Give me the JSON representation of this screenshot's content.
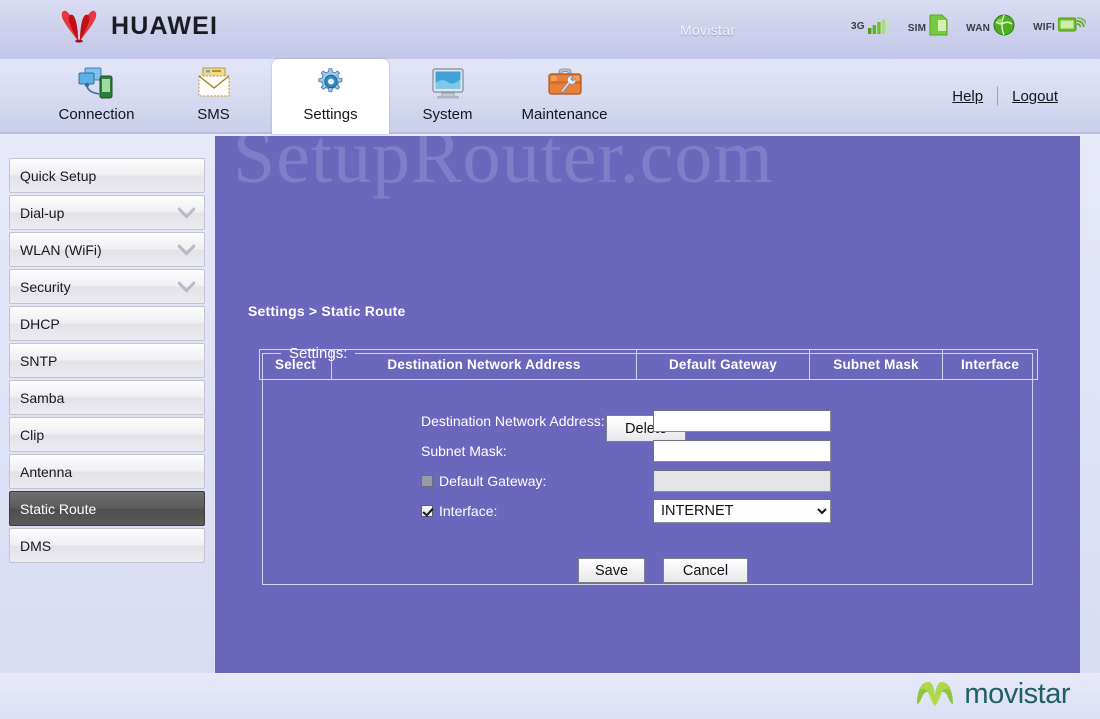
{
  "brand": {
    "vendor": "HUAWEI",
    "carrier": "Movistar",
    "logo_mark": "huawei-petal-logo",
    "logo_color": "#d8121c"
  },
  "status_icons": [
    {
      "label": "3G",
      "icon": "signal-bars-icon",
      "color": "#5eb318"
    },
    {
      "label": "SIM",
      "icon": "sim-card-icon",
      "color": "#7ac943"
    },
    {
      "label": "WAN",
      "icon": "globe-icon",
      "color": "#4caf22"
    },
    {
      "label": "WIFI",
      "icon": "wifi-signal-icon",
      "color": "#6fbf2a"
    }
  ],
  "nav": {
    "tabs": [
      {
        "label": "Connection",
        "icon": "connection-devices-icon",
        "active": false
      },
      {
        "label": "SMS",
        "icon": "envelope-icon",
        "active": false
      },
      {
        "label": "Settings",
        "icon": "gear-icon",
        "active": true
      },
      {
        "label": "System",
        "icon": "monitor-icon",
        "active": false
      },
      {
        "label": "Maintenance",
        "icon": "toolbox-wrench-icon",
        "active": false
      }
    ],
    "help_label": "Help",
    "logout_label": "Logout"
  },
  "sidebar": {
    "items": [
      {
        "label": "Quick Setup",
        "expandable": false,
        "selected": false
      },
      {
        "label": "Dial-up",
        "expandable": true,
        "selected": false
      },
      {
        "label": "WLAN (WiFi)",
        "expandable": true,
        "selected": false
      },
      {
        "label": "Security",
        "expandable": true,
        "selected": false
      },
      {
        "label": "DHCP",
        "expandable": false,
        "selected": false
      },
      {
        "label": "SNTP",
        "expandable": false,
        "selected": false
      },
      {
        "label": "Samba",
        "expandable": false,
        "selected": false
      },
      {
        "label": "Clip",
        "expandable": false,
        "selected": false
      },
      {
        "label": "Antenna",
        "expandable": false,
        "selected": false
      },
      {
        "label": "Static Route",
        "expandable": false,
        "selected": true
      },
      {
        "label": "DMS",
        "expandable": false,
        "selected": false
      }
    ]
  },
  "main": {
    "watermark": "SetupRouter.com",
    "breadcrumb": "Settings > Static Route",
    "table": {
      "headers": [
        "Select",
        "Destination Network Address",
        "Default Gateway",
        "Subnet Mask",
        "Interface"
      ],
      "rows": []
    },
    "delete_label": "Delete",
    "settings": {
      "legend": "Settings:",
      "fields": [
        {
          "label": "Destination Network Address:",
          "value": "",
          "type": "text",
          "checkbox": null,
          "disabled": false
        },
        {
          "label": "Subnet Mask:",
          "value": "",
          "type": "text",
          "checkbox": null,
          "disabled": false
        },
        {
          "label": "Default Gateway:",
          "value": "",
          "type": "text",
          "checkbox": false,
          "disabled": true
        },
        {
          "label": "Interface:",
          "value": "INTERNET",
          "type": "select",
          "checkbox": true,
          "disabled": false,
          "options": [
            "INTERNET"
          ]
        }
      ],
      "save_label": "Save",
      "cancel_label": "Cancel"
    }
  },
  "footer": {
    "brand_word": "movistar",
    "brand_mark": "movistar-m-icon",
    "brand_color": "#8cc63e"
  },
  "theme": {
    "panel_purple": "#6b67bd",
    "header_lilac": "#ccd0ec",
    "selected_gray": "#5c5c5c"
  }
}
